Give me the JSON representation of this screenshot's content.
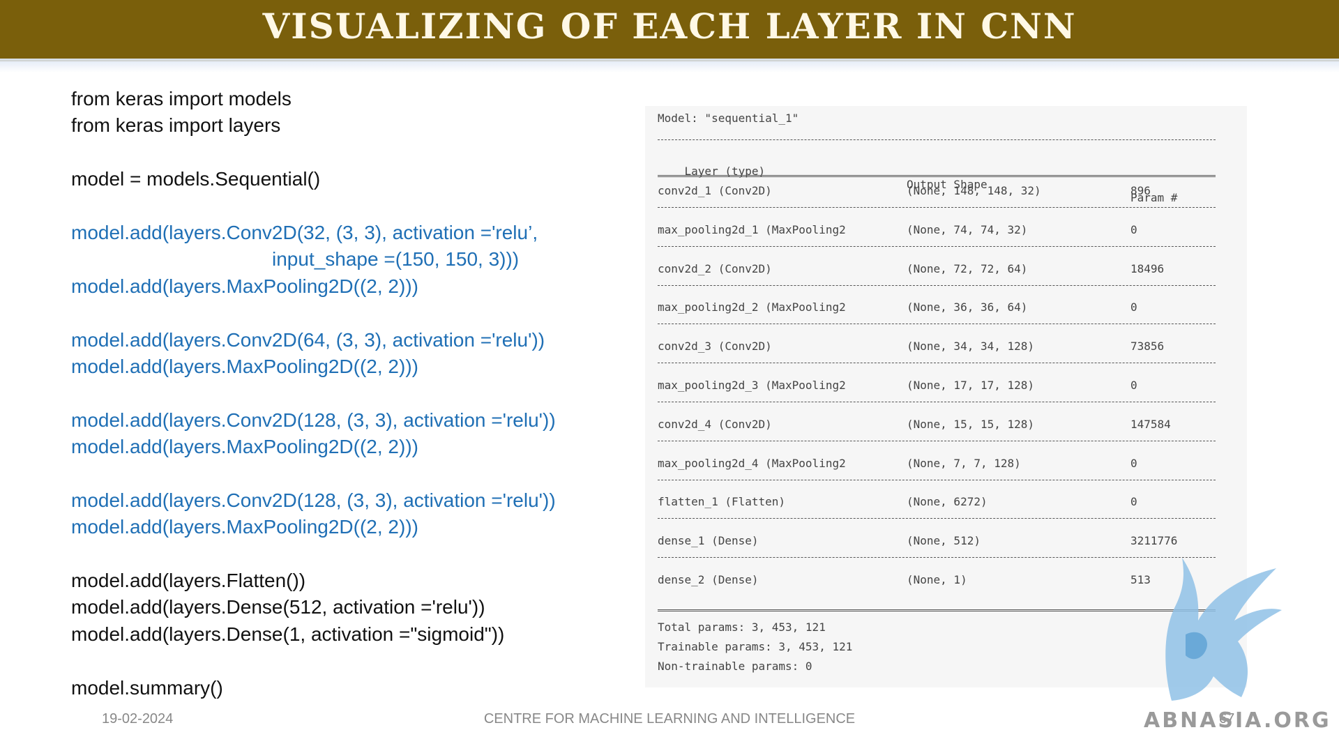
{
  "title": "VISUALIZING OF EACH LAYER IN CNN",
  "code": {
    "lines": [
      "from keras import models",
      "from keras import layers",
      "",
      "model = models.Sequential()",
      "",
      "model.add(layers.Conv2D(32, (3, 3), activation ='relu’,",
      "input_shape =(150, 150, 3)))",
      "model.add(layers.MaxPooling2D((2, 2)))",
      "",
      "model.add(layers.Conv2D(64, (3, 3), activation ='relu'))",
      "model.add(layers.MaxPooling2D((2, 2)))",
      "",
      "model.add(layers.Conv2D(128, (3, 3), activation ='relu'))",
      "model.add(layers.MaxPooling2D((2, 2)))",
      "",
      "model.add(layers.Conv2D(128, (3, 3), activation ='relu'))",
      "model.add(layers.MaxPooling2D((2, 2)))",
      "",
      "model.add(layers.Flatten())",
      "model.add(layers.Dense(512, activation ='relu'))",
      "model.add(layers.Dense(1, activation =\"sigmoid\"))",
      "",
      "model.summary()"
    ]
  },
  "summary": {
    "model_line": "Model: \"sequential_1\"",
    "headers": [
      "Layer (type)",
      "Output Shape",
      "Param #"
    ],
    "rows": [
      {
        "layer": "conv2d_1 (Conv2D)",
        "shape": "(None, 148, 148, 32)",
        "params": "896"
      },
      {
        "layer": "max_pooling2d_1 (MaxPooling2",
        "shape": "(None, 74, 74, 32)",
        "params": "0"
      },
      {
        "layer": "conv2d_2 (Conv2D)",
        "shape": "(None, 72, 72, 64)",
        "params": "18496"
      },
      {
        "layer": "max_pooling2d_2 (MaxPooling2",
        "shape": "(None, 36, 36, 64)",
        "params": "0"
      },
      {
        "layer": "conv2d_3 (Conv2D)",
        "shape": "(None, 34, 34, 128)",
        "params": "73856"
      },
      {
        "layer": "max_pooling2d_3 (MaxPooling2",
        "shape": "(None, 17, 17, 128)",
        "params": "0"
      },
      {
        "layer": "conv2d_4 (Conv2D)",
        "shape": "(None, 15, 15, 128)",
        "params": "147584"
      },
      {
        "layer": "max_pooling2d_4 (MaxPooling2",
        "shape": "(None, 7, 7, 128)",
        "params": "0"
      },
      {
        "layer": "flatten_1 (Flatten)",
        "shape": "(None, 6272)",
        "params": "0"
      },
      {
        "layer": "dense_1 (Dense)",
        "shape": "(None, 512)",
        "params": "3211776"
      },
      {
        "layer": "dense_2 (Dense)",
        "shape": "(None, 1)",
        "params": "513"
      }
    ],
    "total": "Total params: 3, 453, 121",
    "trainable": "Trainable params: 3, 453, 121",
    "non_trainable": "Non-trainable params: 0"
  },
  "footer": {
    "date": "19-02-2024",
    "center": "CENTRE FOR MACHINE LEARNING AND INTELLIGENCE",
    "page": "67"
  },
  "watermark": {
    "text": "ABNASIA.ORG"
  },
  "colors": {
    "title_bar": "#7a5f0b",
    "code_blue": "#1f6fb5"
  }
}
